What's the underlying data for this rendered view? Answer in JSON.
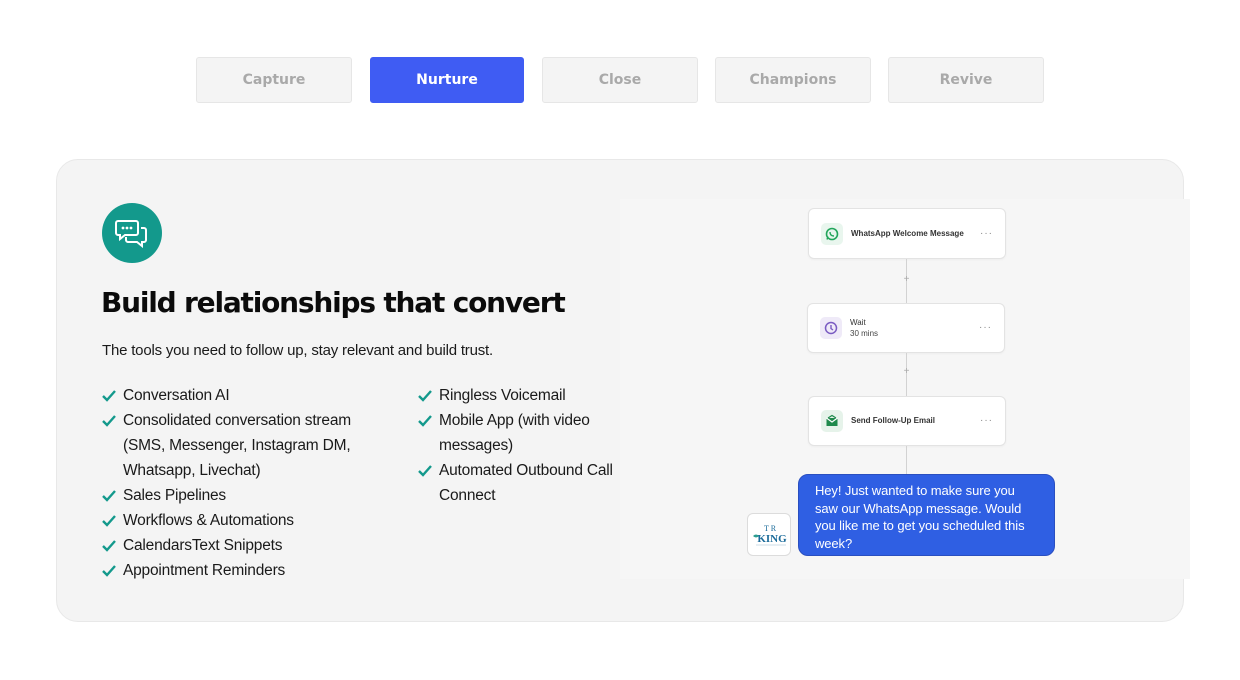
{
  "tabs": [
    {
      "label": "Capture",
      "active": false
    },
    {
      "label": "Nurture",
      "active": true
    },
    {
      "label": "Close",
      "active": false
    },
    {
      "label": "Champions",
      "active": false
    },
    {
      "label": "Revive",
      "active": false
    }
  ],
  "feature": {
    "icon": "chat-bubbles-icon",
    "headline": "Build relationships that convert",
    "subline": "The tools you need to follow up, stay relevant and build trust.",
    "features_left": [
      "Conversation AI",
      "Consolidated conversation stream (SMS, Messenger, Instagram DM, Whatsapp, Livechat)",
      "Sales Pipelines",
      "Workflows & Automations",
      "CalendarsText Snippets",
      "Appointment Reminders"
    ],
    "features_right": [
      "Ringless Voicemail",
      "Mobile App (with video messages)",
      "Automated Outbound Call Connect"
    ]
  },
  "workflow": {
    "step1": {
      "title": "WhatsApp Welcome Message",
      "icon": "whatsapp-icon"
    },
    "step2": {
      "title": "Wait",
      "detail": "30 mins",
      "icon": "clock-icon"
    },
    "step3": {
      "title": "Send Follow-Up Email",
      "icon": "email-icon"
    },
    "more": "···",
    "add": "+"
  },
  "chat": {
    "message": "Hey! Just wanted to make sure you saw our WhatsApp message. Would you like me to get you scheduled this week?",
    "avatar_text_top": "T R",
    "avatar_text_main": "KING"
  },
  "colors": {
    "accent": "#3f5cf3",
    "teal": "#13998c",
    "bubble": "#2f5fe3"
  }
}
